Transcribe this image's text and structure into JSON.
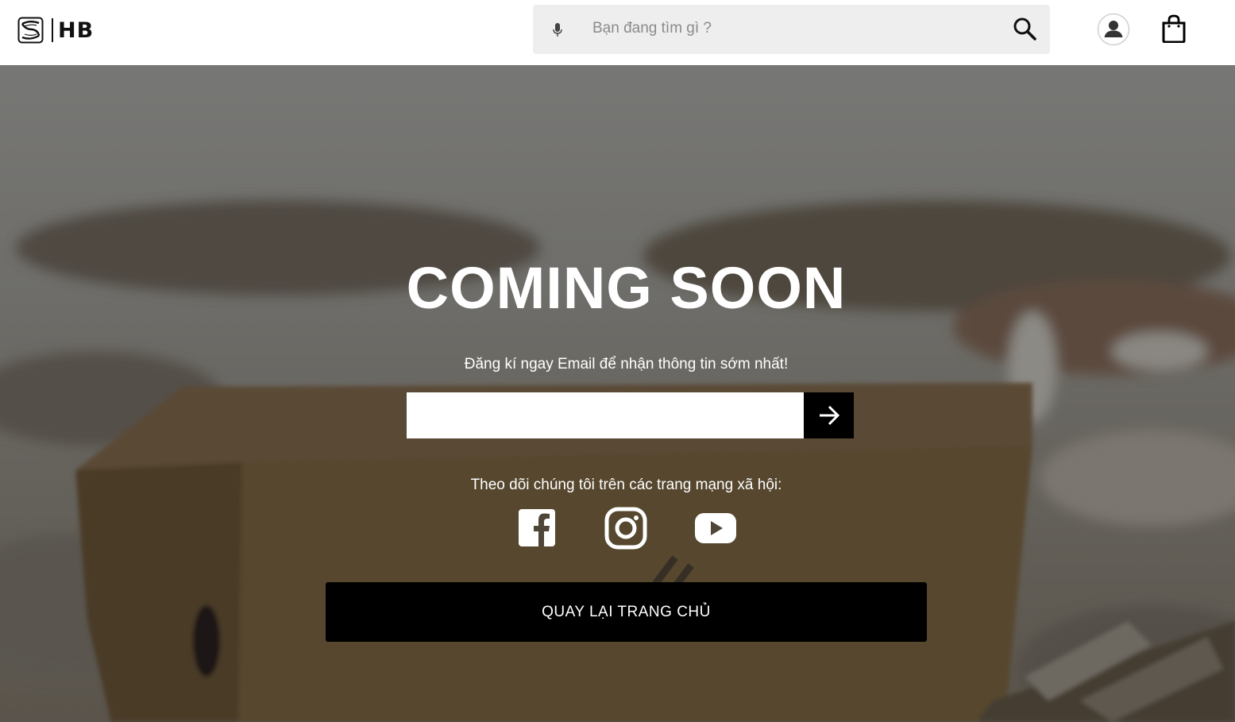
{
  "header": {
    "logo_text": "HB",
    "search": {
      "placeholder": "Bạn đang tìm gì ?"
    }
  },
  "main": {
    "title": "COMING SOON",
    "subtitle": "Đăng kí ngay Email để nhận thông tin sớm nhất!",
    "email_input": {
      "value": "",
      "placeholder": ""
    },
    "follow_text": "Theo dõi chúng tôi trên các trang mạng xã hội:",
    "social": [
      "facebook-icon",
      "instagram-icon",
      "youtube-icon"
    ],
    "home_button_label": "QUAY LẠI TRANG CHỦ"
  },
  "colors": {
    "header_bg": "#ffffff",
    "search_bg": "#eeeeee",
    "button_bg": "#000000",
    "text_on_dark": "#ffffff"
  }
}
